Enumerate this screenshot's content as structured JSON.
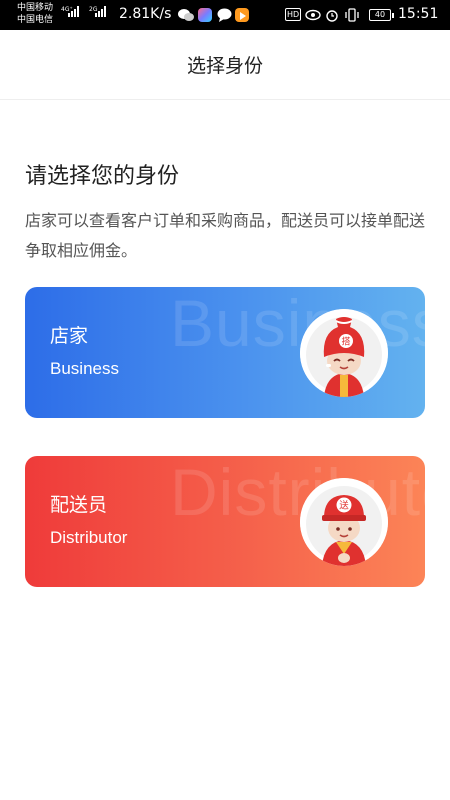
{
  "status_bar": {
    "carrier_1": "中国移动",
    "carrier_2": "中国电信",
    "net_1": "4G⁺",
    "net_2": "2G",
    "speed": "2.81K/s",
    "hd": "HD",
    "battery": "40",
    "time": "15:51"
  },
  "header": {
    "title": "选择身份"
  },
  "intro": {
    "heading": "请选择您的身份",
    "description": "店家可以查看客户订单和采购商品，配送员可以接单配送争取相应佣金。"
  },
  "roles": [
    {
      "title": "店家",
      "subtitle": "Business",
      "watermark": "Business",
      "badge": "搭",
      "gradient": [
        "#2d6de8",
        "#63b2ef"
      ]
    },
    {
      "title": "配送员",
      "subtitle": "Distributor",
      "watermark": "Distributor",
      "badge": "送",
      "gradient": [
        "#ef3b3a",
        "#fc8457"
      ]
    }
  ],
  "colors": {
    "hat_red": "#e0312f",
    "skin": "#f5d9c5",
    "outline": "#7a2b22"
  }
}
